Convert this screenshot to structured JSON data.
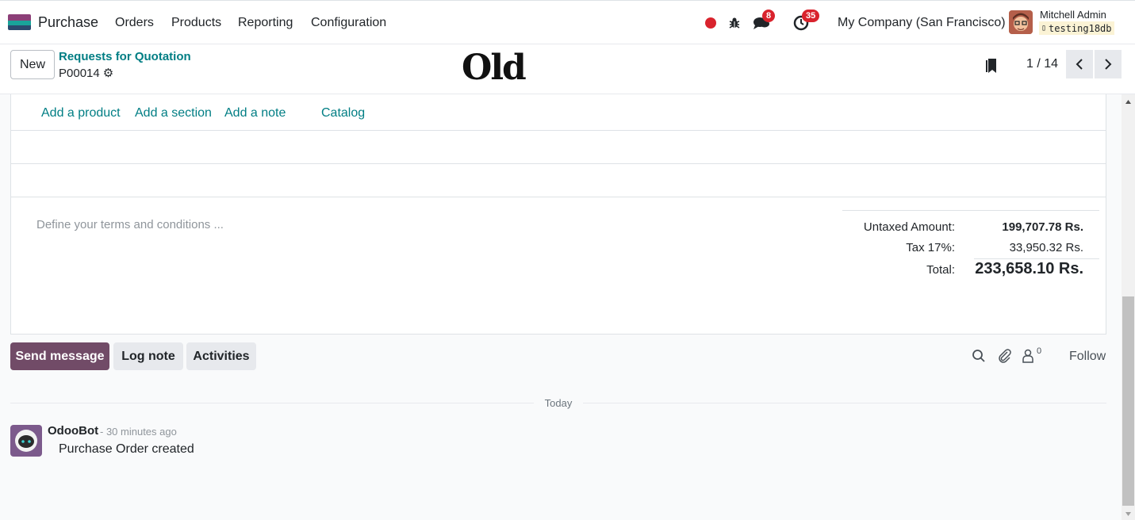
{
  "navbar": {
    "app_name": "Purchase",
    "menu": [
      "Orders",
      "Products",
      "Reporting",
      "Configuration"
    ],
    "messages_count": "8",
    "activities_count": "35",
    "company": "My Company (San Francisco)",
    "user_name": "Mitchell Admin",
    "database": "testing18db"
  },
  "control_panel": {
    "new_label": "New",
    "breadcrumb": "Requests for Quotation",
    "record_name": "P00014",
    "watermark": "Old",
    "pager": "1 / 14"
  },
  "order_lines": {
    "add_product": "Add a product",
    "add_section": "Add a section",
    "add_note": "Add a note",
    "catalog": "Catalog"
  },
  "terms_placeholder": "Define your terms and conditions ...",
  "totals": {
    "untaxed_label": "Untaxed Amount:",
    "untaxed_value": "199,707.78 Rs.",
    "tax_label": "Tax 17%:",
    "tax_value": "33,950.32 Rs.",
    "total_label": "Total:",
    "total_value": "233,658.10 Rs."
  },
  "chatter": {
    "send_message": "Send message",
    "log_note": "Log note",
    "activities": "Activities",
    "followers_count": "0",
    "follow": "Follow",
    "date_separator": "Today",
    "messages": [
      {
        "author": "OdooBot",
        "time": "- 30 minutes ago",
        "body": "Purchase Order created"
      }
    ]
  },
  "colors": {
    "brand": "#714b67",
    "link": "#017e84",
    "badge": "#d9232d"
  }
}
